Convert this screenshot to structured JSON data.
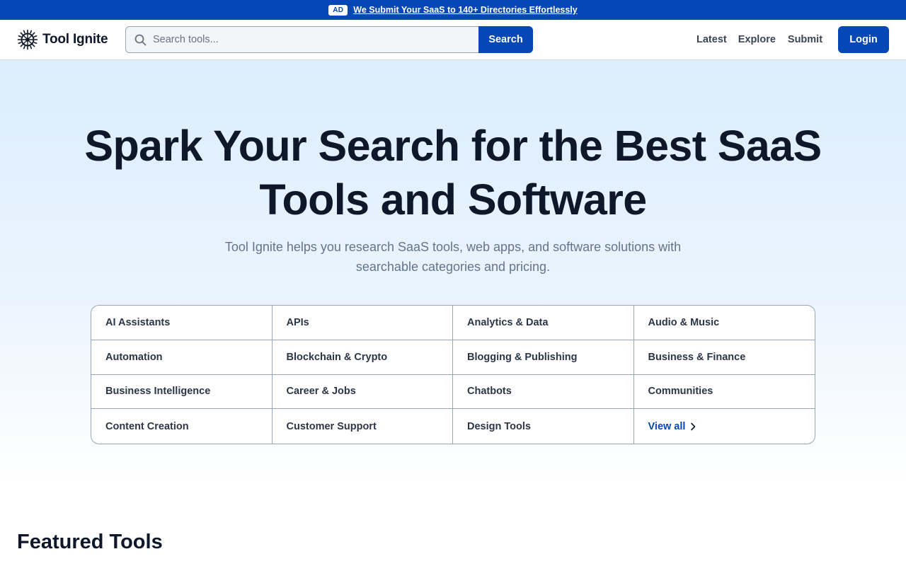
{
  "ad_banner": {
    "badge": "AD",
    "text": "We Submit Your SaaS to 140+ Directories Effortlessly"
  },
  "header": {
    "logo_text": "Tool Ignite",
    "logo_icon": "sun-burst-icon",
    "search": {
      "placeholder": "Search tools...",
      "value": "",
      "button_label": "Search"
    },
    "nav": {
      "latest": "Latest",
      "explore": "Explore",
      "submit": "Submit"
    },
    "login_label": "Login"
  },
  "hero": {
    "title": "Spark Your Search for the Best SaaS Tools and Software",
    "subtitle": "Tool Ignite helps you research SaaS tools, web apps, and software solutions with searchable categories and pricing."
  },
  "categories": [
    "AI Assistants",
    "APIs",
    "Analytics & Data",
    "Audio & Music",
    "Automation",
    "Blockchain & Crypto",
    "Blogging & Publishing",
    "Business & Finance",
    "Business Intelligence",
    "Career & Jobs",
    "Chatbots",
    "Communities",
    "Content Creation",
    "Customer Support",
    "Design Tools"
  ],
  "view_all_label": "View all",
  "featured": {
    "title": "Featured Tools"
  },
  "colors": {
    "brand": "#0447b5",
    "heading": "#0f172a",
    "muted": "#64748b",
    "hero_bg_top": "#dcedfd"
  }
}
